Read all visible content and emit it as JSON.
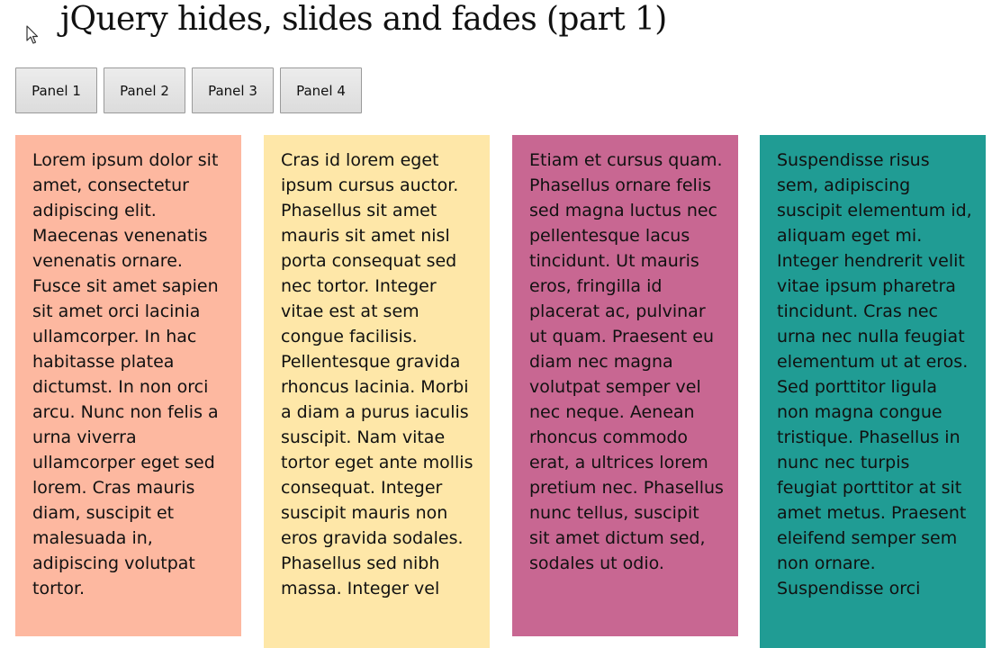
{
  "page": {
    "title": "jQuery hides, slides and fades (part 1)"
  },
  "buttons": [
    {
      "label": "Panel 1"
    },
    {
      "label": "Panel 2"
    },
    {
      "label": "Panel 3"
    },
    {
      "label": "Panel 4"
    }
  ],
  "colors": {
    "panel_1": "#fdb8a0",
    "panel_2": "#fee7a8",
    "panel_3": "#c86792",
    "panel_4": "#209c94"
  },
  "panels": [
    {
      "text": "Lorem ipsum dolor sit amet, consectetur adipiscing elit. Maecenas venenatis venenatis ornare. Fusce sit amet sapien sit amet orci lacinia ullamcorper. In hac habitasse platea dictumst. In non orci arcu. Nunc non felis a urna viverra ullamcorper eget sed lorem. Cras mauris diam, suscipit et malesuada in, adipiscing volutpat tortor."
    },
    {
      "text": "Cras id lorem eget ipsum cursus auctor. Phasellus sit amet mauris sit amet nisl porta consequat sed nec tortor. Integer vitae est at sem congue facilisis. Pellentesque gravida rhoncus lacinia. Morbi a diam a purus iaculis suscipit. Nam vitae tortor eget ante mollis consequat. Integer suscipit mauris non eros gravida sodales. Phasellus sed nibh massa. Integer vel"
    },
    {
      "text": "Etiam et cursus quam. Phasellus ornare felis sed magna luctus nec pellentesque lacus tincidunt. Ut mauris eros, fringilla id placerat ac, pulvinar ut quam. Praesent eu diam nec magna volutpat semper vel nec neque. Aenean rhoncus commodo erat, a ultrices lorem pretium nec. Phasellus nunc tellus, suscipit sit amet dictum sed, sodales ut odio."
    },
    {
      "text": "Suspendisse risus sem, adipiscing suscipit elementum id, aliquam eget mi. Integer hendrerit velit vitae ipsum pharetra tincidunt. Cras nec urna nec nulla feugiat elementum ut at eros. Sed porttitor ligula non magna congue tristique. Phasellus in nunc nec turpis feugiat porttitor at sit amet metus. Praesent eleifend semper sem non ornare. Suspendisse orci"
    }
  ]
}
